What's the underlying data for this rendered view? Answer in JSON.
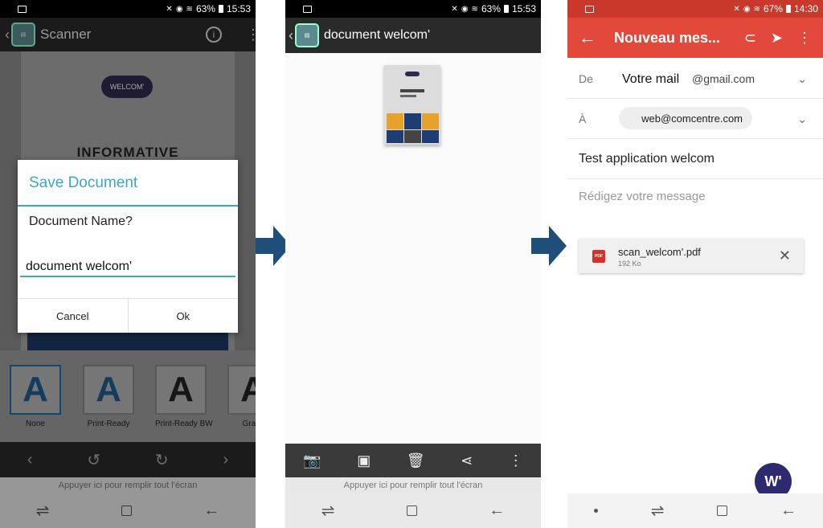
{
  "status1": {
    "battery": "63%",
    "time": "15:53"
  },
  "status2": {
    "battery": "63%",
    "time": "15:53"
  },
  "status3": {
    "battery": "67%",
    "time": "14:30"
  },
  "screen1": {
    "app_title": "Scanner",
    "doc_logo": "WELCOM'",
    "doc_heading": "INFORMATIVE",
    "dialog": {
      "title": "Save Document",
      "question": "Document Name?",
      "value": "document welcom'",
      "cancel": "Cancel",
      "ok": "Ok"
    },
    "filters": [
      {
        "glyph": "A",
        "label": "None"
      },
      {
        "glyph": "A",
        "label": "Print-Ready"
      },
      {
        "glyph": "A",
        "label": "Print-Ready BW"
      },
      {
        "glyph": "A",
        "label": "Grays"
      }
    ],
    "fill_hint": "Appuyer ici pour remplir tout l'écran"
  },
  "screen2": {
    "title": "document welcom'",
    "fill_hint": "Appuyer ici pour remplir tout l'écran"
  },
  "screen3": {
    "title": "Nouveau mes...",
    "from_label": "De",
    "from_name": "Votre mail",
    "from_domain": "@gmail.com",
    "to_label": "À",
    "to_chip": "web@comcentre.com",
    "subject": "Test application welcom",
    "compose_placeholder": "Rédigez votre message",
    "attachment": {
      "name": "scan_welcom'.pdf",
      "size": "192 Ko",
      "badge": "PDF"
    },
    "logo_letter": "W'"
  },
  "colors": {
    "accent_blue": "#3aa6cc",
    "gmail_red": "#e3493b",
    "arrow": "#1f4e79",
    "brand": "#2e2a6f"
  }
}
